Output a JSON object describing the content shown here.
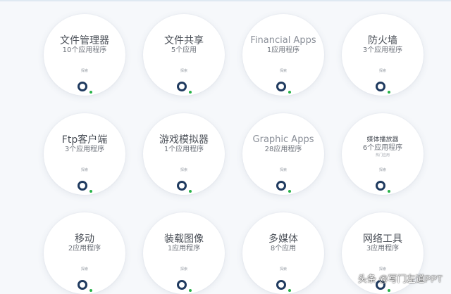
{
  "cards": [
    {
      "title": "文件管理器",
      "count": "10个应用程序",
      "explore": "探索"
    },
    {
      "title": "文件共享",
      "count": "5个应用",
      "explore": "探索"
    },
    {
      "title": "Financial Apps",
      "count": "1应用程序",
      "explore": "探索"
    },
    {
      "title": "防火墙",
      "count": "3个应用程序",
      "explore": "探索"
    },
    {
      "title": "Ftp客户端",
      "count": "3个应用程序",
      "explore": "探索"
    },
    {
      "title": "游戏模拟器",
      "count": "1个应用程序",
      "explore": "探索"
    },
    {
      "title": "Graphic Apps",
      "count": "28应用程序",
      "explore": "探索"
    },
    {
      "title": "媒体播放器",
      "count": "6个应用程序",
      "subtitle": "热门应用",
      "explore": "探索"
    },
    {
      "title": "移动",
      "count": "2应用程序",
      "explore": "探索"
    },
    {
      "title": "装载图像",
      "count": "1应用程序",
      "explore": "探索"
    },
    {
      "title": "多媒体",
      "count": "8个应用",
      "explore": "探索"
    },
    {
      "title": "网络工具",
      "count": "3应用程序",
      "explore": "探索"
    }
  ],
  "watermark": "头条 @写门左道PPT",
  "colors": {
    "background": "#f6f8fb",
    "card": "#ffffff",
    "ring": "#1f3a5f",
    "ring_dot": "#29b34a"
  }
}
